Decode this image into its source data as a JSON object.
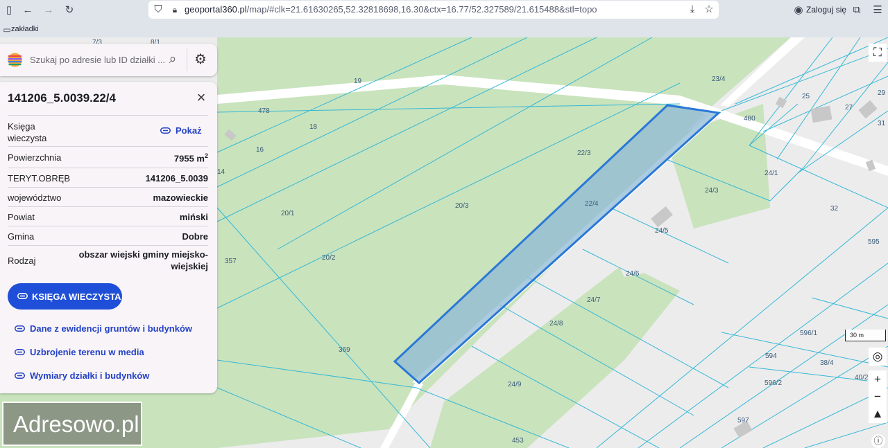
{
  "browser": {
    "url_host": "geoportal360.pl",
    "url_rest": "/map/#clk=21.61630265,52.32818698,16.30&ctx=16.77/52.327589/21.615488&stl=topo",
    "login_label": "Zaloguj się",
    "bookmarks_label": "zakładki"
  },
  "search": {
    "placeholder": "Szukaj po adresie lub ID działki ..."
  },
  "parcel": {
    "id": "141206_5.0039.22/4",
    "kw_label": "Księga wieczysta",
    "kw_show": "Pokaż",
    "area_label": "Powierzchnia",
    "area_value": "7955 m",
    "area_unit_sup": "2",
    "teryt_label": "TERYT.OBRĘB",
    "teryt_value": "141206_5.0039",
    "voivodeship_label": "województwo",
    "voivodeship_value": "mazowieckie",
    "county_label": "Powiat",
    "county_value": "miński",
    "commune_label": "Gmina",
    "commune_value": "Dobre",
    "type_label": "Rodzaj",
    "type_value": "obszar wiejski gminy miejsko-wiejskiej",
    "kw_button": "KSIĘGA WIECZYSTA",
    "links": [
      "Dane z ewidencji gruntów i budynków",
      "Uzbrojenie terenu w media",
      "Wymiary działki i budynków"
    ]
  },
  "map": {
    "parcel_labels": [
      "7/3",
      "8/1",
      "19",
      "478",
      "18",
      "16",
      "14",
      "20/1",
      "20/3",
      "22/3",
      "22/4",
      "357",
      "20/2",
      "369",
      "24/9",
      "453",
      "23/4",
      "25",
      "27",
      "29",
      "31",
      "480",
      "24/1",
      "24/3",
      "32",
      "24/5",
      "595",
      "24/6",
      "24/7",
      "24/8",
      "596/1",
      "594",
      "38/4",
      "596/2",
      "40/2",
      "597"
    ],
    "scale": "30 m",
    "colors": {
      "green": "#c9e3bd",
      "grey": "#ececec",
      "road": "#ffffff",
      "parcel_line": "#35b8d6",
      "selection_fill": "#8fbad6",
      "selection_stroke": "#2a78d8"
    }
  },
  "watermark": "Adresowo.pl"
}
